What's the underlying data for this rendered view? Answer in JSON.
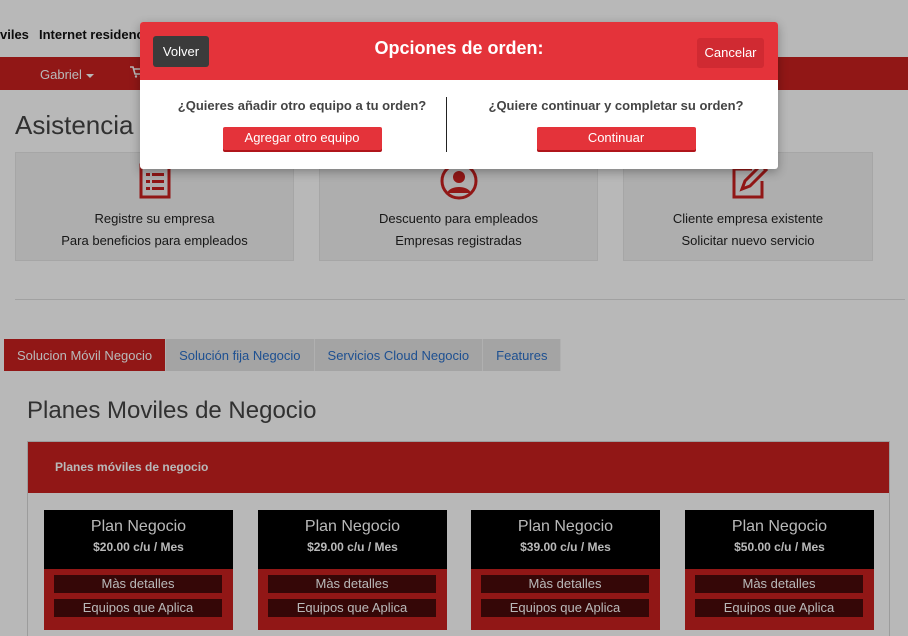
{
  "nav": {
    "link_moviles": "viles",
    "link_internet": "Internet residenc",
    "user": "Gabriel"
  },
  "page_title": "Asistencia /",
  "cards": [
    {
      "line1": "Registre su empresa",
      "line2": "Para beneficios para empleados",
      "icon": "form-icon"
    },
    {
      "line1": "Descuento para empleados",
      "line2": "Empresas registradas",
      "icon": "user-icon"
    },
    {
      "line1": "Cliente empresa existente",
      "line2": "Solicitar nuevo servicio",
      "icon": "edit-icon"
    }
  ],
  "tabs": [
    "Solucion Móvil Negocio",
    "Solución fija Negocio",
    "Servicios Cloud Negocio",
    "Features"
  ],
  "plans_title": "Planes Moviles de Negocio",
  "panel_title": "Planes móviles de negocio",
  "plans": [
    {
      "name": "Plan Negocio",
      "price": "$20.00 c/u / Mes",
      "details": "Màs detalles",
      "devices": "Equipos que Aplica"
    },
    {
      "name": "Plan Negocio",
      "price": "$29.00 c/u / Mes",
      "details": "Màs detalles",
      "devices": "Equipos que Aplica"
    },
    {
      "name": "Plan Negocio",
      "price": "$39.00 c/u / Mes",
      "details": "Màs detalles",
      "devices": "Equipos que Aplica"
    },
    {
      "name": "Plan Negocio",
      "price": "$50.00 c/u / Mes",
      "details": "Màs detalles",
      "devices": "Equipos que Aplica"
    }
  ],
  "modal": {
    "title": "Opciones de orden:",
    "back_label": "Volver",
    "cancel_label": "Cancelar",
    "left_question": "¿Quieres añadir otro equipo a tu orden?",
    "left_action": "Agregar otro equipo",
    "right_question": "¿Quiere continuar y completar su orden?",
    "right_action": "Continuar"
  },
  "colors": {
    "brand_red": "#c9201f",
    "modal_red": "#e4333a",
    "plan_dark": "#000000"
  }
}
